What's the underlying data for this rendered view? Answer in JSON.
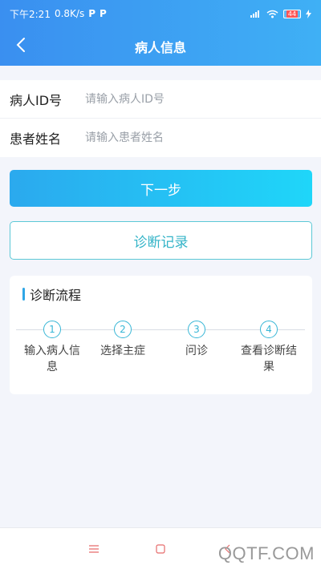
{
  "status_bar": {
    "time": "下午2:21",
    "speed": "0.8K/s",
    "app_icon_1": "P",
    "app_icon_2": "P",
    "battery": "44",
    "icons": [
      "signal-icon",
      "wifi-icon",
      "battery-icon",
      "charging-icon"
    ]
  },
  "header": {
    "title": "病人信息",
    "back_icon": "chevron-left-icon"
  },
  "form": {
    "patient_id_label": "病人ID号",
    "patient_id_placeholder": "请输入病人ID号",
    "patient_id_value": "",
    "patient_name_label": "患者姓名",
    "patient_name_placeholder": "请输入患者姓名",
    "patient_name_value": ""
  },
  "buttons": {
    "next_label": "下一步",
    "record_label": "诊断记录"
  },
  "flow": {
    "title": "诊断流程",
    "steps": [
      {
        "num": "1",
        "label": "输入病人信息"
      },
      {
        "num": "2",
        "label": "选择主症"
      },
      {
        "num": "3",
        "label": "问诊"
      },
      {
        "num": "4",
        "label": "查看诊断结果"
      }
    ]
  },
  "system_nav": {
    "icons": [
      "menu-icon",
      "home-icon",
      "back-icon"
    ]
  },
  "watermark": "QQTF.COM",
  "colors": {
    "header_start": "#3a8ff0",
    "header_end": "#3fb0f5",
    "next_start": "#2ba9ee",
    "next_end": "#1fd6f9",
    "accent": "#34b4c8",
    "system_nav_icon": "#e66b6b"
  }
}
